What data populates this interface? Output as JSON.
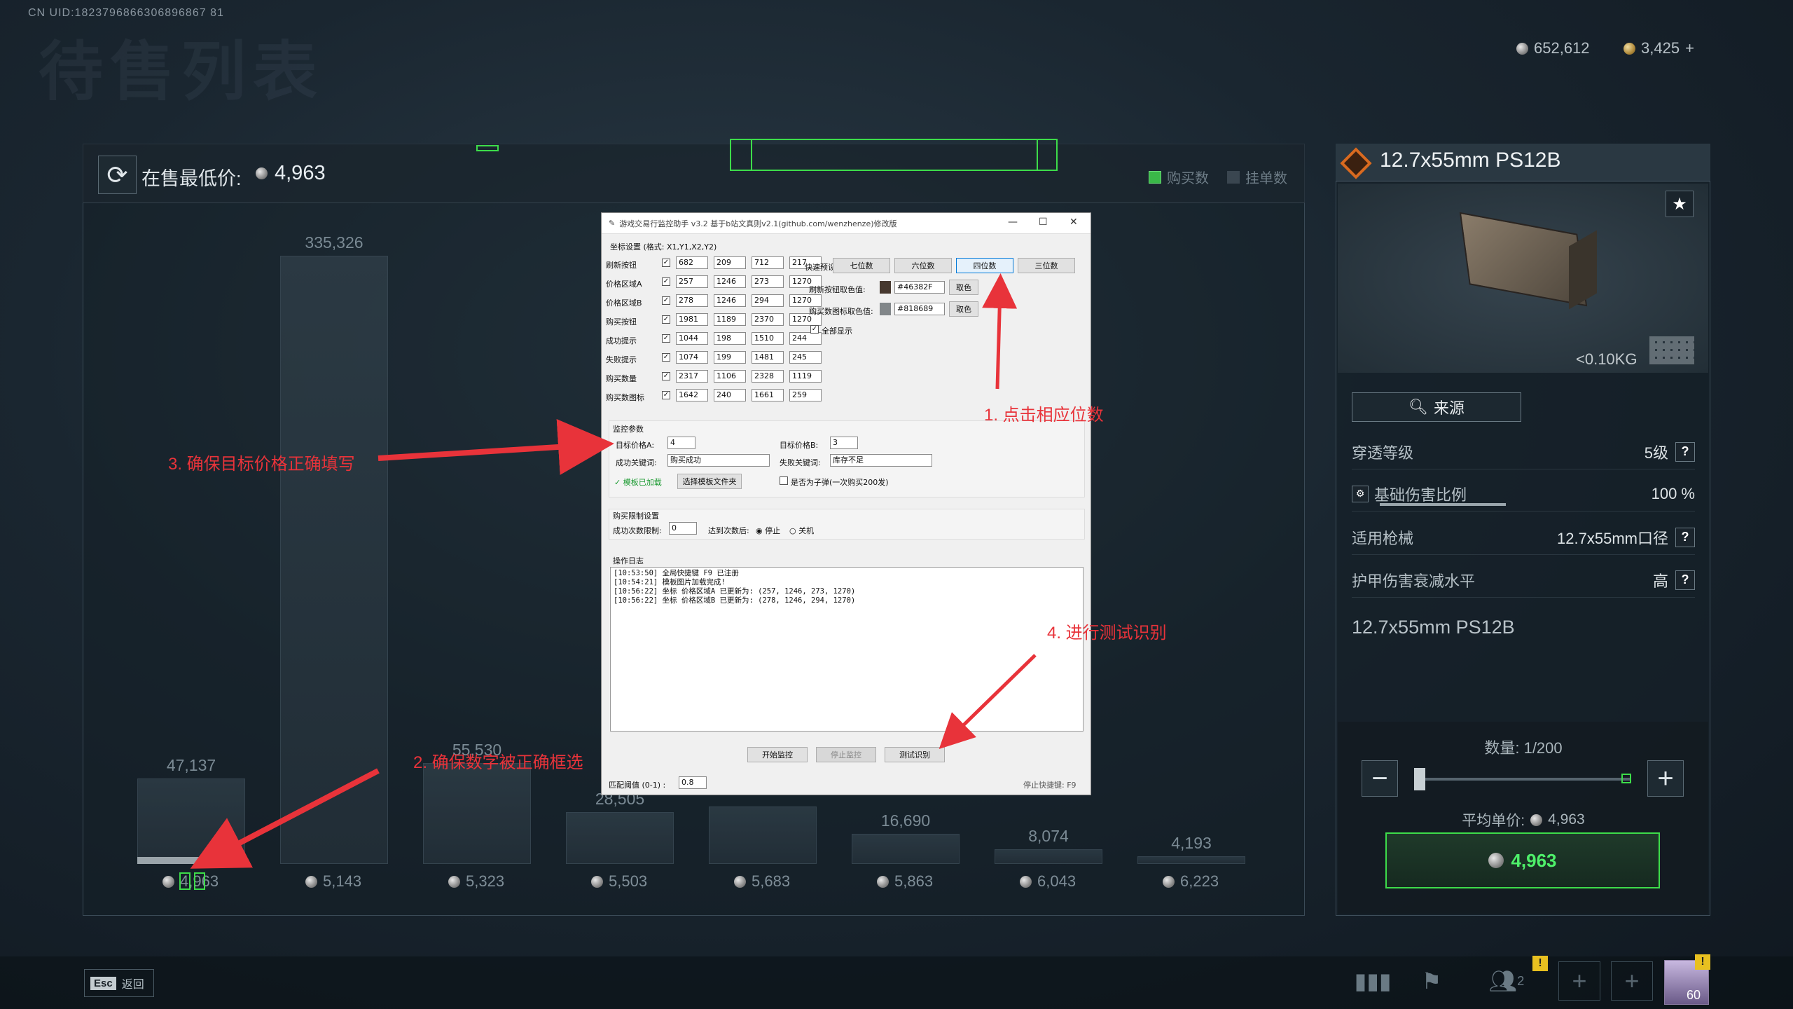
{
  "uid": "CN UID:1823796866306896867 81",
  "bg_title": "待售列表",
  "balance": {
    "silver": "652,612",
    "gold": "3,425"
  },
  "lowest": {
    "label": "在售最低价:",
    "value": "4,963"
  },
  "legend": {
    "buy": "购买数",
    "list": "挂单数"
  },
  "chart_data": {
    "type": "bar",
    "categories": [
      "4,963",
      "5,143",
      "5,323",
      "5,503",
      "5,683",
      "5,863",
      "6,043",
      "6,223"
    ],
    "values": [
      47137,
      335326,
      55530,
      28505,
      31700,
      16690,
      8074,
      4193
    ],
    "data_labels": [
      "47,137",
      "335,326",
      "55,530",
      "28,505",
      "",
      "16,690",
      "8,074",
      "4,193"
    ],
    "ylim": [
      0,
      340000
    ]
  },
  "item": {
    "name": "12.7x55mm PS12B",
    "weight": "<0.10KG",
    "source_label": "来源",
    "props": [
      {
        "label": "穿透等级",
        "value": "5级"
      },
      {
        "label": "基础伤害比例",
        "value": "100 %"
      },
      {
        "label": "适用枪械",
        "value": "12.7x55mm口径"
      },
      {
        "label": "护甲伤害衰减水平",
        "value": "高"
      }
    ],
    "subname": "12.7x55mm PS12B",
    "qty": "数量: 1/200",
    "avg_label": "平均单价:",
    "avg_value": "4,963",
    "buy_value": "4,963"
  },
  "bottom": {
    "esc_key": "Esc",
    "esc_label": "返回",
    "friends": "2",
    "level": "60"
  },
  "dialog": {
    "title": "游戏交易行监控助手 v3.2 基于b站文真则v2.1(github.com/wenzhenze)修改版",
    "coords_title": "坐标设置 (格式: X1,Y1,X2,Y2)",
    "rows": [
      {
        "label": "刷新按钮",
        "v": [
          "682",
          "209",
          "712",
          "217"
        ]
      },
      {
        "label": "价格区域A",
        "v": [
          "257",
          "1246",
          "273",
          "1270"
        ]
      },
      {
        "label": "价格区域B",
        "v": [
          "278",
          "1246",
          "294",
          "1270"
        ]
      },
      {
        "label": "购买按钮",
        "v": [
          "1981",
          "1189",
          "2370",
          "1270"
        ]
      },
      {
        "label": "成功提示",
        "v": [
          "1044",
          "198",
          "1510",
          "244"
        ]
      },
      {
        "label": "失败提示",
        "v": [
          "1074",
          "199",
          "1481",
          "245"
        ]
      },
      {
        "label": "购买数量",
        "v": [
          "2317",
          "1106",
          "2328",
          "1119"
        ]
      },
      {
        "label": "购买数图标",
        "v": [
          "1642",
          "240",
          "1661",
          "259"
        ]
      }
    ],
    "preset_label": "快速预设:",
    "presets": [
      "七位数",
      "六位数",
      "四位数",
      "三位数"
    ],
    "refresh_color_label": "刷新按钮取色值:",
    "refresh_color": "#46382F",
    "qty_color_label": "购买数图标取色值:",
    "qty_color": "#818689",
    "pick_label": "取色",
    "show_all": "全部显示",
    "monitor_title": "监控参数",
    "target_a_label": "目标价格A:",
    "target_a": "4",
    "target_b_label": "目标价格B:",
    "target_b": "3",
    "success_kw_label": "成功关键词:",
    "success_kw": "购买成功",
    "fail_kw_label": "失败关键词:",
    "fail_kw": "库存不足",
    "template_loaded": "模板已加载",
    "choose_template": "选择模板文件夹",
    "bullet_mode": "是否为子弹(一次购买200发)",
    "limit_title": "购买限制设置",
    "limit_label": "成功次数限制:",
    "limit_value": "0",
    "after_label": "达到次数后:",
    "stop_label": "停止",
    "shutdown_label": "关机",
    "log_title": "操作日志",
    "log": [
      "[10:53:50] 全局快捷键 F9 已注册",
      "[10:54:21] 模板图片加载完成!",
      "[10:56:22] 坐标 价格区域A 已更新为: (257, 1246, 273, 1270)",
      "[10:56:22] 坐标 价格区域B 已更新为: (278, 1246, 294, 1270)"
    ],
    "start_btn": "开始监控",
    "stop_btn": "停止监控",
    "test_btn": "测试识别",
    "threshold_label": "匹配阈值 (0-1) :",
    "threshold": "0.8",
    "hotkey": "停止快捷键: F9"
  },
  "annotations": {
    "a1": "1. 点击相应位数",
    "a2": "2. 确保数字被正确框选",
    "a3": "3. 确保目标价格正确填写",
    "a4": "4. 进行测试识别"
  }
}
